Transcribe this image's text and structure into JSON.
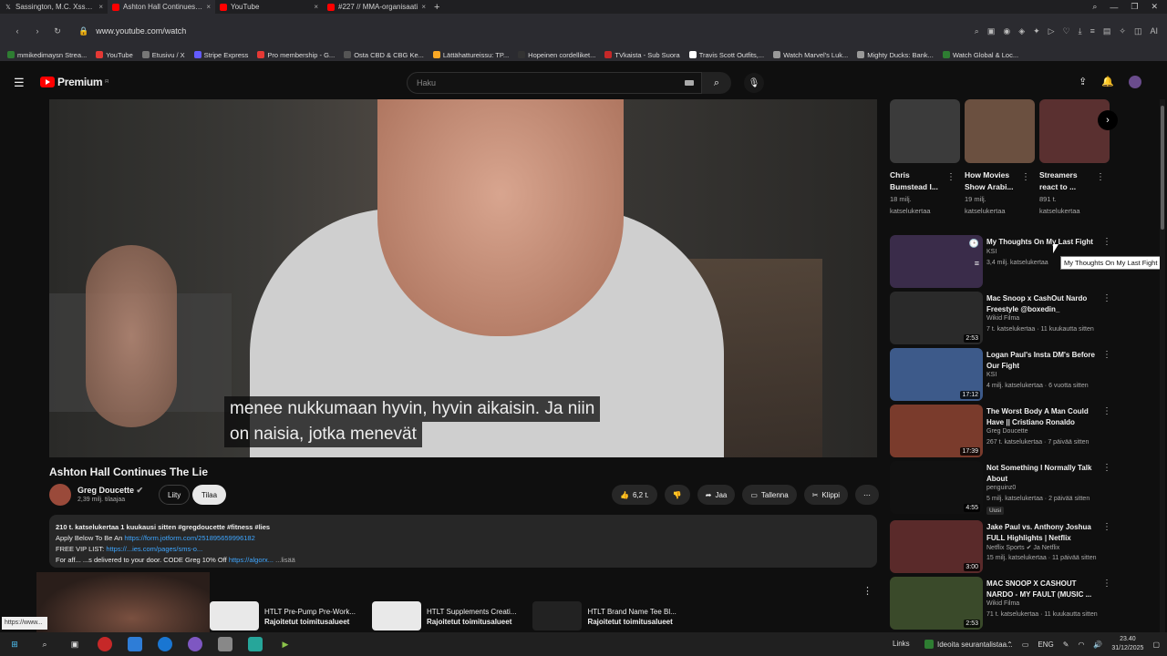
{
  "browser": {
    "tabs": [
      {
        "title": "Sassington, M.C. Xssà° 🐇",
        "icon": "x-icon",
        "active": false
      },
      {
        "title": "Ashton Hall Continues Th",
        "icon": "youtube-icon",
        "active": true
      },
      {
        "title": "YouTube",
        "icon": "youtube-icon",
        "active": false
      },
      {
        "title": "#227 // MMA-organisaati",
        "icon": "youtube-icon",
        "active": false
      }
    ],
    "new_tab": "+",
    "url": "www.youtube.com/watch",
    "bookmarks": [
      {
        "label": "mmikedimaysn Strea...",
        "color": "#2e7d32"
      },
      {
        "label": "YouTube",
        "color": "#e53935"
      },
      {
        "label": "Etusivu / X",
        "color": "#777"
      },
      {
        "label": "Stripe Express",
        "color": "#635bff"
      },
      {
        "label": "Pro membership - G...",
        "color": "#e53935"
      },
      {
        "label": "Osta CBD & CBG Ke...",
        "color": "#555"
      },
      {
        "label": "Lättähattureissu: TP...",
        "color": "#f9a825"
      },
      {
        "label": "Hopeinen cordelliket...",
        "color": "#333"
      },
      {
        "label": "TVkaista - Sub Suora",
        "color": "#c62828"
      },
      {
        "label": "Travis Scott Outfits,...",
        "color": "#fff"
      },
      {
        "label": "Watch Marvel's Luk...",
        "color": "#999"
      },
      {
        "label": "Mighty Ducks: Bank...",
        "color": "#999"
      },
      {
        "label": "Watch Global & Loc...",
        "color": "#2e7d32"
      }
    ]
  },
  "youtube": {
    "logo": "Premium",
    "logo_sup": "FI",
    "search_placeholder": "Haku",
    "video": {
      "subtitle_line1": "menee nukkumaan hyvin, hyvin aikaisin.  Ja niin",
      "subtitle_line2": "on naisia, jotka menevät"
    },
    "title": "Ashton Hall Continues The Lie",
    "channel": {
      "name": "Greg Doucette",
      "subs": "2,39 milj. tilaajaa"
    },
    "join_label": "Liity",
    "subscribe_label": "Tilaa",
    "actions": {
      "likes": "6,2 t.",
      "share": "Jaa",
      "save": "Tallenna",
      "clip": "Klippi"
    },
    "description": {
      "line1": "210 t. katselukertaa  1 kuukausi sitten  #gregdoucette #fitness #lies",
      "line2_prefix": "Apply Below To Be An ",
      "line2_link": "https://form.jotform.com/251895659996182",
      "line3_prefix": "FREE VIP LIST: ",
      "line3_link": "https://...ies.com/pages/sms-o...",
      "line4_prefix": "For aff...  ...s delivered to your door. CODE Greg 10% Off ",
      "line4_link": "https://algorx...",
      "more": "...lisää"
    },
    "products": [
      {
        "title": "HTLT Pre-Pump Pre-Work...",
        "status": "Rajoitetut toimitusalueet"
      },
      {
        "title": "HTLT Supplements Creati...",
        "status": "Rajoitetut toimitusalueet"
      },
      {
        "title": "HTLT Brand Name Tee Bl...",
        "status": "Rajoitetut toimitusalueet"
      }
    ],
    "status_url": "https://www...",
    "shelf": [
      {
        "title": "Chris Bumstead I...",
        "views": "18 milj.",
        "views_label": "katselukertaa"
      },
      {
        "title": "How Movies Show Arabi...",
        "views": "19 milj.",
        "views_label": "katselukertaa"
      },
      {
        "title": "Streamers react to ...",
        "views": "891 t.",
        "views_label": "katselukertaa"
      }
    ],
    "related": [
      {
        "title": "My Thoughts On My Last Fight",
        "channel": "KSI",
        "meta": "3,4 milj. katselukertaa",
        "duration": "",
        "thumb": "#3a2c4a"
      },
      {
        "title": "Mac Snoop x CashOut Nardo Freestyle @boxedin_",
        "channel": "Wikid Filma",
        "meta": "7 t. katselukertaa · 11 kuukautta sitten",
        "duration": "2:53",
        "thumb": "#2a2a2a"
      },
      {
        "title": "Logan Paul's Insta DM's Before Our Fight",
        "channel": "KSI",
        "meta": "4 milj. katselukertaa · 6 vuotta sitten",
        "duration": "17:12",
        "thumb": "#3d5a8a"
      },
      {
        "title": "The Worst Body A Man Could Have || Cristiano Ronaldo",
        "channel": "Greg Doucette",
        "meta": "267 t. katselukertaa · 7 päivää sitten",
        "duration": "17:39",
        "thumb": "#7a3b2c"
      },
      {
        "title": "Not Something I Normally Talk About",
        "channel": "penguinz0",
        "meta": "5 milj. katselukertaa · 2 päivää sitten",
        "duration": "4:55",
        "badge": "Uusi",
        "thumb": "#d8d8d8"
      },
      {
        "title": "Jake Paul vs. Anthony Joshua FULL Highlights | Netflix",
        "channel": "Netflix Sports",
        "meta": "15 milj. katselukertaa · 11 päivää sitten",
        "duration": "3:00",
        "thumb": "#5a2a2a"
      },
      {
        "title": "MAC SNOOP X CASHOUT NARDO - MY FAULT (MUSIC ...",
        "channel": "Wikid Filma",
        "meta": "71 t. katselukertaa · 11 kuukautta sitten",
        "duration": "2:53",
        "thumb": "#3a4a2a"
      }
    ],
    "tooltip": "My Thoughts On My Last Fight",
    "ksi_netflix_channel_extra": "Ja Netflix"
  },
  "taskbar": {
    "links": "Links",
    "news": "Ideoita seurantalistaa...",
    "lang": "ENG",
    "time": "23.40",
    "date": "31/12/2025"
  }
}
